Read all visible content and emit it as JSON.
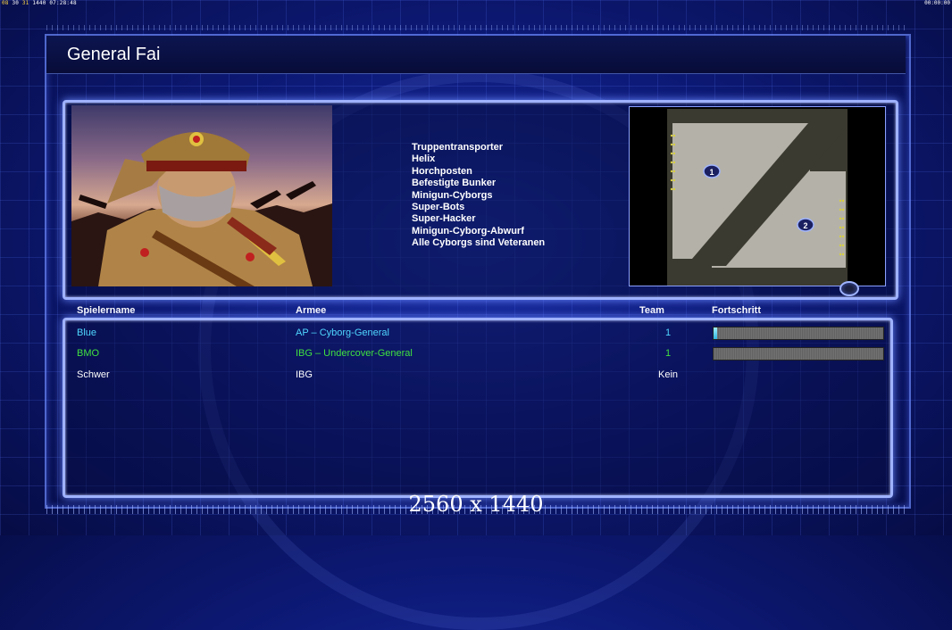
{
  "hud": {
    "top_left_a": "08",
    "top_left_b": "30",
    "top_left_c": "31",
    "top_left_d": "1440",
    "top_left_time": "07:28:48",
    "top_right": "00:00:00"
  },
  "general": {
    "title": "General Fai",
    "bonuses": [
      "Truppentransporter",
      "Helix",
      "Horchposten",
      "Befestigte Bunker",
      "Minigun-Cyborgs",
      "Super-Bots",
      "Super-Hacker",
      "Minigun-Cyborg-Abwurf",
      "Alle Cyborgs sind Veteranen"
    ]
  },
  "map": {
    "markers": [
      "1",
      "2"
    ]
  },
  "table": {
    "headers": {
      "player": "Spielername",
      "army": "Armee",
      "team": "Team",
      "progress": "Fortschritt"
    },
    "rows": [
      {
        "player": "Blue",
        "army": "AP – Cyborg-General",
        "team": "1",
        "progress": 0.02,
        "color": "#4fd6ff"
      },
      {
        "player": "BMO",
        "army": "IBG – Undercover-General",
        "team": "1",
        "progress": 0.0,
        "color": "#40e040"
      },
      {
        "player": "Schwer",
        "army": "IBG",
        "team": "Kein",
        "color": "#ffffff"
      }
    ]
  },
  "resolution_label": "2560 x 1440",
  "colors": {
    "background": "#0d1a78",
    "panel_border": "#9fb2ff"
  }
}
